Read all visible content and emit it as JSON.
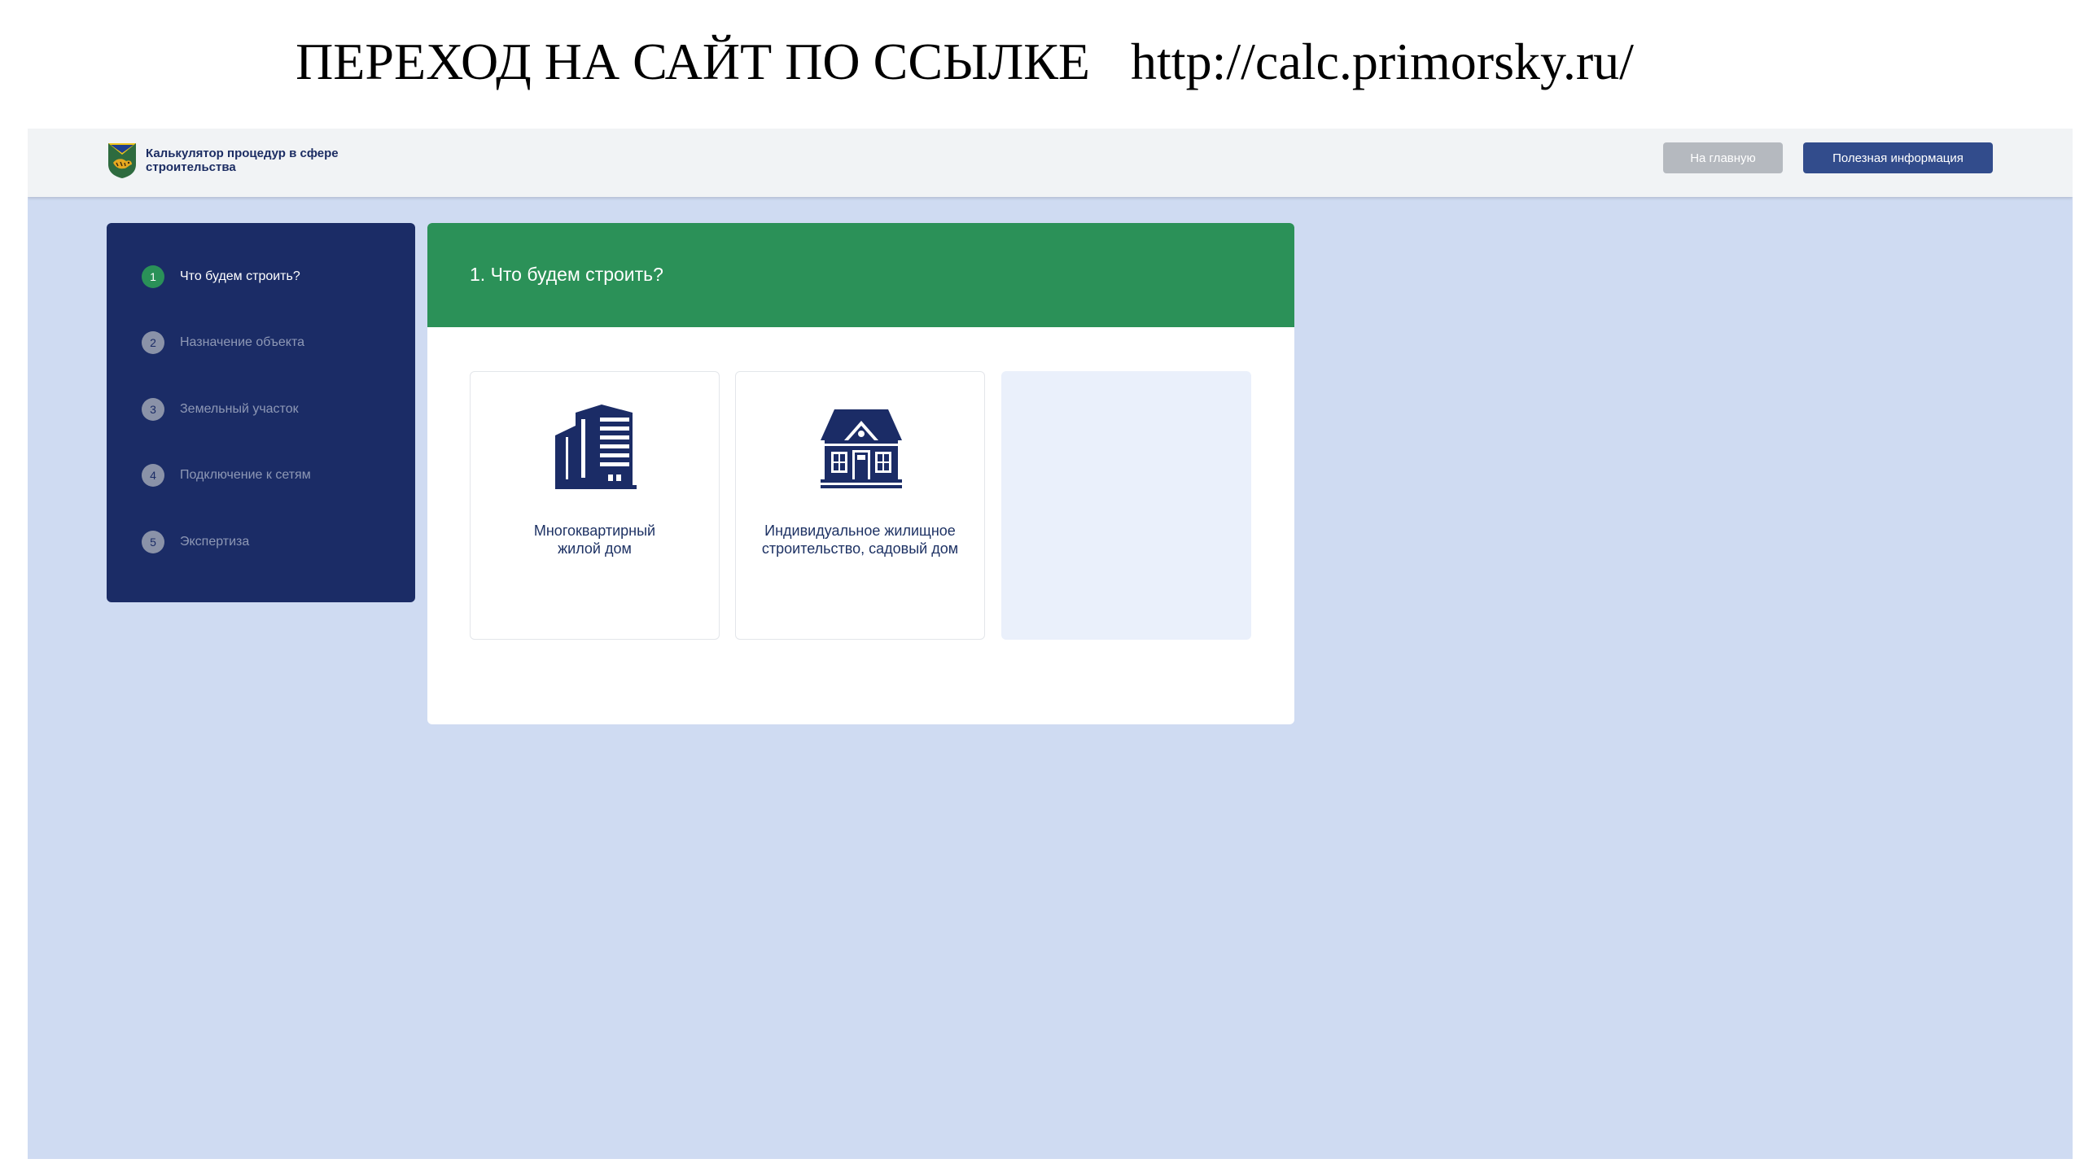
{
  "slide": {
    "title": "ПЕРЕХОД НА САЙТ ПО ССЫЛКЕ",
    "url": "http://calc.primorsky.ru/"
  },
  "header": {
    "app_title": "Калькулятор процедур в сфере строительства",
    "home_button": "На главную",
    "info_button": "Полезная информация"
  },
  "steps": [
    {
      "number": "1",
      "label": "Что будем строить?",
      "active": true
    },
    {
      "number": "2",
      "label": "Назначение объекта",
      "active": false
    },
    {
      "number": "3",
      "label": "Земельный участок",
      "active": false
    },
    {
      "number": "4",
      "label": "Подключение к сетям",
      "active": false
    },
    {
      "number": "5",
      "label": "Экспертиза",
      "active": false
    }
  ],
  "main": {
    "title": "1. Что будем строить?",
    "options": [
      {
        "label": "Многоквартирный жилой дом",
        "icon": "apartment-building-icon"
      },
      {
        "label": "Индивидуальное жилищное строительство, садовый дом",
        "icon": "house-icon"
      }
    ]
  },
  "colors": {
    "sidebar": "#1b2c66",
    "accent_green": "#2b9158",
    "page_background": "#cfdbf2",
    "primary_button": "#324c8c",
    "secondary_button": "#b5b9bf"
  }
}
